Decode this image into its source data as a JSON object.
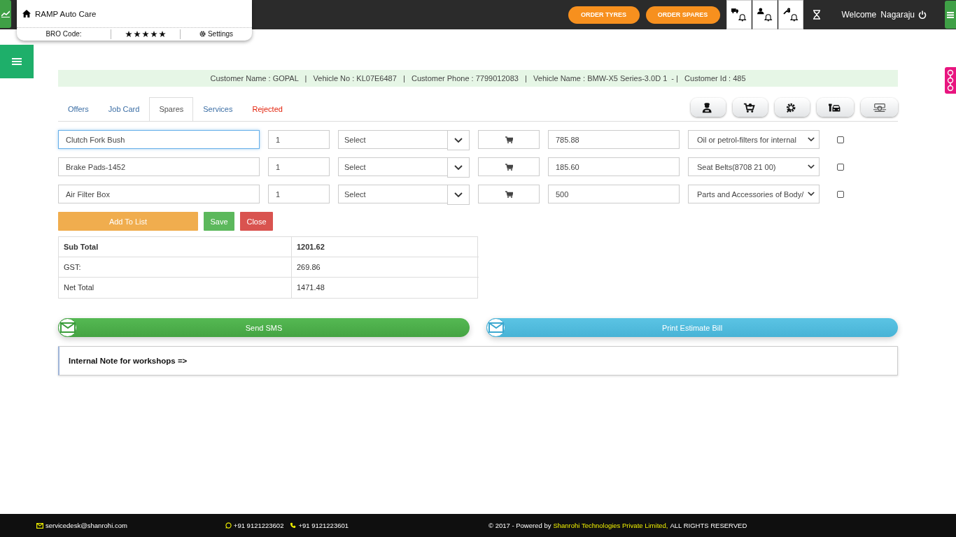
{
  "header": {
    "brand": "RAMP Auto Care",
    "bro_code_label": "BRO Code:",
    "stars": 5,
    "settings": "Settings",
    "order_buttons": [
      "ORDER TYRES",
      "ORDER SPARES"
    ],
    "notifications": [
      {
        "kind": "truck"
      },
      {
        "kind": "user"
      },
      {
        "kind": "wrench"
      }
    ],
    "welcome": "Welcome",
    "user": "Nagaraju"
  },
  "customer_info": "Customer Name : GOPAL   |   Vehicle No : KL07E6487   |   Customer Phone : 7799012083   |   Vehicle Name : BMW-X5 Series-3.0D 1  - |   Customer Id : 485",
  "tabs": [
    {
      "label": "Offers",
      "selected": false,
      "kind": "normal"
    },
    {
      "label": "Job Card",
      "selected": false,
      "kind": "normal"
    },
    {
      "label": "Spares",
      "selected": true,
      "kind": "normal"
    },
    {
      "label": "Services",
      "selected": false,
      "kind": "normal"
    },
    {
      "label": "Rejected",
      "selected": false,
      "kind": "rejected"
    }
  ],
  "tool_buttons": [
    {
      "kind": "mechanic"
    },
    {
      "kind": "cart"
    },
    {
      "kind": "gear"
    },
    {
      "kind": "car"
    },
    {
      "kind": "engine"
    }
  ],
  "rows": [
    {
      "part": "Clutch Fork Bush",
      "qty": "1",
      "unit": "Select",
      "price": "785.88",
      "category": "Oil or petrol-filters for internal",
      "checked": false,
      "focused": true
    },
    {
      "part": "Brake Pads-1452",
      "qty": "1",
      "unit": "Select",
      "price": "185.60",
      "category": "Seat Belts(8708 21 00)",
      "checked": false,
      "focused": false
    },
    {
      "part": "Air Filter Box",
      "qty": "1",
      "unit": "Select",
      "price": "500",
      "category": "Parts and Accessories of Body/",
      "checked": false,
      "focused": false
    }
  ],
  "actions": [
    {
      "label": "Add To List",
      "kind": "add"
    },
    {
      "label": "Save",
      "kind": "save"
    },
    {
      "label": "Close",
      "kind": "close"
    }
  ],
  "totals": [
    {
      "label": "Sub Total",
      "value": "1201.62",
      "bold": true
    },
    {
      "label": "GST:",
      "value": "269.86",
      "bold": false
    },
    {
      "label": "Net Total",
      "value": "1471.48",
      "bold": false
    }
  ],
  "send_sms": "Send SMS",
  "print_bill": "Print Estimate Bill",
  "note": "Internal Note for workshops =>",
  "footer": {
    "email": "servicedesk@shanrohi.com",
    "phones": [
      "+91 9121223602",
      "+91 9121223601"
    ],
    "copyright": "© 2017 - Powered by",
    "company": "Shanrohi Technologies Private Limited,",
    "rights": "ALL RIGHTS RESERVED"
  }
}
